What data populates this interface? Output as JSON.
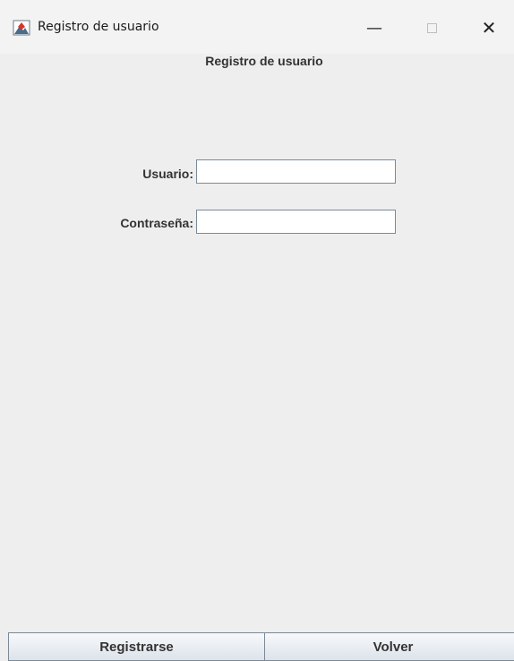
{
  "window": {
    "title": "Registro de usuario",
    "icon": "java-app-icon",
    "controls": {
      "minimize": "—",
      "maximize": "□",
      "close": "✕"
    }
  },
  "header": {
    "title": "Registro de usuario"
  },
  "form": {
    "username_label": "Usuario:",
    "username_value": "",
    "password_label": "Contraseña:",
    "password_value": ""
  },
  "actions": {
    "register_label": "Registrarse",
    "back_label": "Volver"
  }
}
